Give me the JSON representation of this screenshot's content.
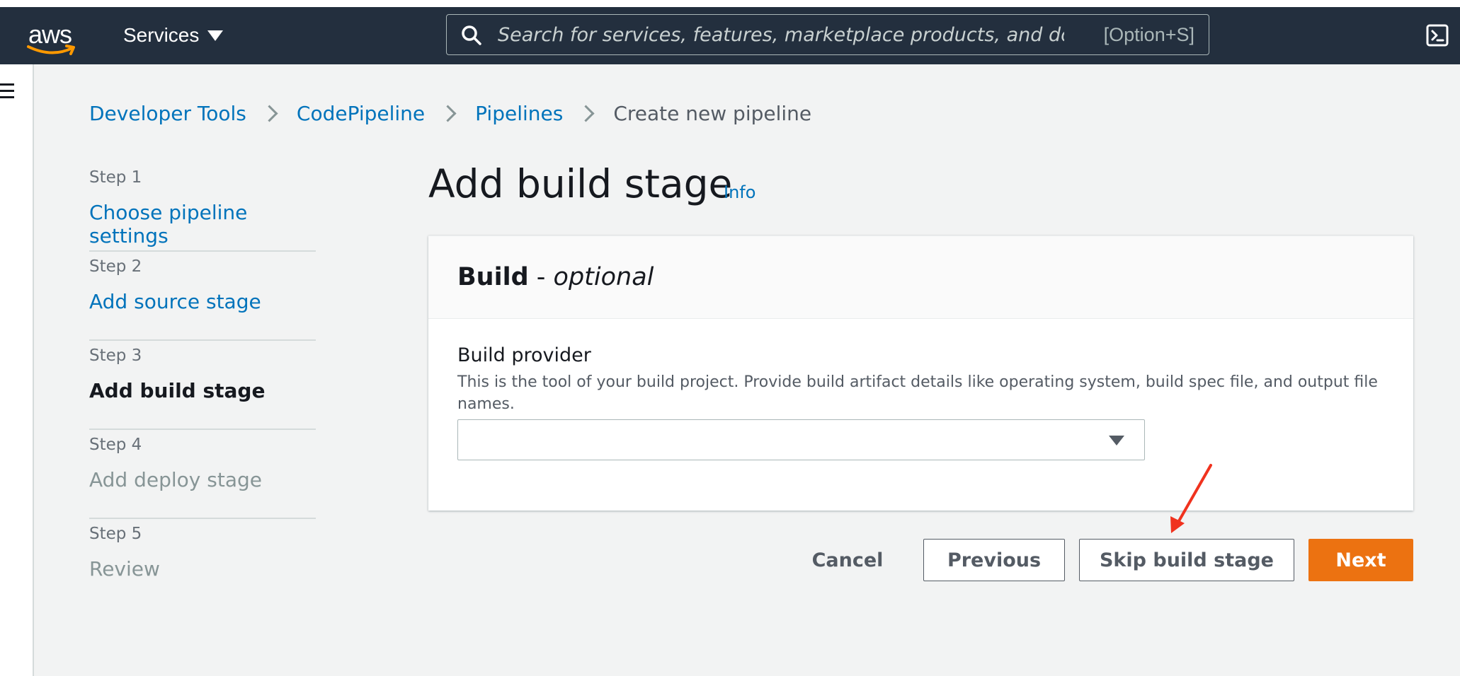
{
  "header": {
    "logo_text": "aws",
    "services_label": "Services",
    "search_placeholder": "Search for services, features, marketplace products, and docs",
    "search_shortcut": "[Option+S]"
  },
  "breadcrumb": {
    "items": [
      "Developer Tools",
      "CodePipeline",
      "Pipelines"
    ],
    "current": "Create new pipeline"
  },
  "steps": [
    {
      "num": "Step 1",
      "title": "Choose pipeline settings",
      "state": "link"
    },
    {
      "num": "Step 2",
      "title": "Add source stage",
      "state": "link"
    },
    {
      "num": "Step 3",
      "title": "Add build stage",
      "state": "active"
    },
    {
      "num": "Step 4",
      "title": "Add deploy stage",
      "state": "disabled"
    },
    {
      "num": "Step 5",
      "title": "Review",
      "state": "disabled"
    }
  ],
  "page": {
    "title": "Add build stage",
    "info_label": "Info"
  },
  "panel": {
    "header_bold": "Build",
    "header_sep": " - ",
    "header_italic": "optional",
    "field_label": "Build provider",
    "field_description": "This is the tool of your build project. Provide build artifact details like operating system, build spec file, and output file names.",
    "select_value": ""
  },
  "actions": {
    "cancel": "Cancel",
    "previous": "Previous",
    "skip": "Skip build stage",
    "next": "Next"
  },
  "colors": {
    "nav_bg": "#232f3e",
    "link": "#0073bb",
    "primary": "#ec7211",
    "annotation_arrow": "#f0321e"
  }
}
